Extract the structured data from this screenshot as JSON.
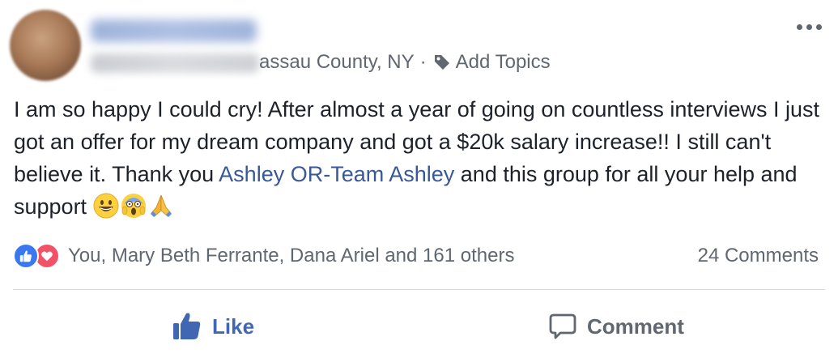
{
  "post": {
    "location": "assau County, NY",
    "separator": "·",
    "add_topics": "Add Topics",
    "text_before": "I am so happy I could cry! After almost a year of going on countless interviews I just got an offer for my dream company and got a $20k salary increase!! I still can't believe it. Thank you ",
    "mention": "Ashley OR-Team Ashley",
    "text_after": " and this group for all your help and support ",
    "emojis": [
      "grinning-face",
      "face-screaming-in-fear",
      "folded-hands"
    ]
  },
  "reactions": {
    "types": [
      "like",
      "love"
    ],
    "summary": "You, Mary Beth Ferrante, Dana Ariel and 161 others"
  },
  "comments": {
    "count_label": "24 Comments"
  },
  "actions": {
    "like_label": "Like",
    "comment_label": "Comment"
  },
  "colors": {
    "link": "#385898",
    "like_active": "#4267b2",
    "muted": "#606770",
    "like_reaction": "#3b78f0",
    "love_reaction": "#f25268"
  }
}
